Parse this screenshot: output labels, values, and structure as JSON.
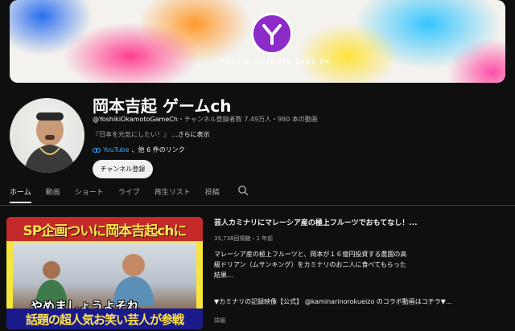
{
  "banner": {
    "tagline": "YOSHIKI OKAMOTO GAME CH"
  },
  "channel": {
    "name": "岡本吉起 ゲームch",
    "handle": "@YoshikiOkamotoGameCh",
    "meta_rest": "・チャンネル登録者数 7.49万人・980 本の動画",
    "description": "『日本を元気にしたい！』",
    "more": "...さらに表示",
    "link_site": "YouTube",
    "link_rest": "、他 6 件のリンク",
    "subscribe_label": "チャンネル登録"
  },
  "tabs": [
    {
      "label": "ホーム",
      "active": true
    },
    {
      "label": "動画"
    },
    {
      "label": "ショート"
    },
    {
      "label": "ライブ"
    },
    {
      "label": "再生リスト"
    },
    {
      "label": "投稿"
    }
  ],
  "featured": {
    "thumb_top_text": "SP企画ついに岡本吉起chに",
    "thumb_overlay_text": "やめましょうよそれ",
    "thumb_bottom_text": "話題の超人気お笑い芸人が参戦",
    "title": "芸人カミナリにマレーシア産の極上フルーツでおもてなし！...",
    "stats": "35,738回視聴・1 年前",
    "description": "マレーシア産の極上フルーツと、岡本が１６億円投資する農園の高級ドリアン（ムサンキング）をカミナリのお二人に食べてもらった結果...",
    "description2": "▼カミナリの記録映像【公式】 @kaminarinorokueizo のコラボ動画はコチラ▼...",
    "more": "詳細"
  }
}
